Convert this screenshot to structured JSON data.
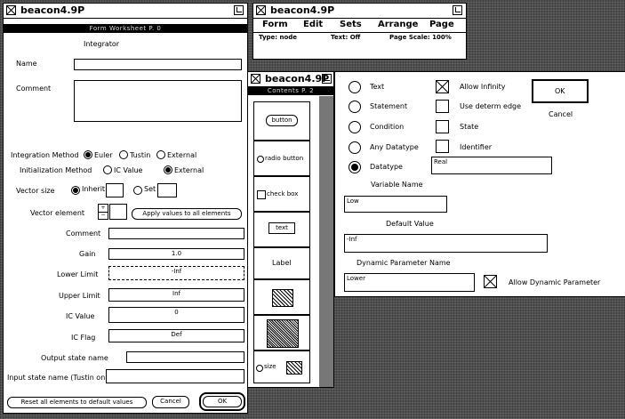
{
  "form_window": {
    "title": "beacon4.9P",
    "banner": "Form Worksheet P. 0",
    "heading": "Integrator",
    "name_label": "Name",
    "comment_label": "Comment",
    "integration_method_label": "Integration Method",
    "integration_options": [
      "Euler",
      "Tustin",
      "External"
    ],
    "integration_selected": "Euler",
    "init_method_label": "Initialization Method",
    "init_options": [
      "IC Value",
      "External"
    ],
    "init_selected": "External",
    "vector_size_label": "Vector size",
    "vector_size_options": [
      "Inherit",
      "Set"
    ],
    "vector_size_selected": "Inherit",
    "vector_element_label": "Vector element",
    "apply_button": "Apply values to all elements",
    "rows": [
      {
        "label": "Comment",
        "value": ""
      },
      {
        "label": "Gain",
        "value": "1.0"
      },
      {
        "label": "Lower Limit",
        "value": "-Inf"
      },
      {
        "label": "Upper Limit",
        "value": "Inf"
      },
      {
        "label": "IC Value",
        "value": "0"
      },
      {
        "label": "IC Flag",
        "value": "Def"
      },
      {
        "label": "Output state name",
        "value": ""
      },
      {
        "label": "Input state name (Tustin only)",
        "value": ""
      }
    ],
    "reset_button": "Reset all elements to default values",
    "cancel_button": "Cancel",
    "ok_button": "OK"
  },
  "edit_window": {
    "title": "beacon4.9P",
    "menu": [
      "Form",
      "Edit",
      "Sets",
      "Arrange",
      "Page"
    ],
    "type_label": "Type: node",
    "text_label": "Text: Off",
    "scale_label": "Page Scale: 100%"
  },
  "palette_window": {
    "title": "beacon4.9P",
    "banner": "Contents P. 2",
    "items": [
      "button",
      "radio button",
      "check box",
      "text",
      "Label"
    ],
    "size_label": "size"
  },
  "properties": {
    "datatypes": [
      "Text",
      "Statement",
      "Condition",
      "Any Datatype",
      "Datatype"
    ],
    "datatype_selected": "Datatype",
    "checkboxes": [
      {
        "label": "Allow Infinity",
        "checked": true
      },
      {
        "label": "Use determ edge",
        "checked": false
      },
      {
        "label": "State",
        "checked": false
      },
      {
        "label": "Identifier",
        "checked": false
      }
    ],
    "datatype_value": "Real",
    "variable_name_label": "Variable Name",
    "variable_name_value": "Low",
    "default_value_label": "Default Value",
    "default_value_value": "-Inf",
    "dyn_param_label": "Dynamic Parameter Name",
    "dyn_param_value": "Lower",
    "allow_dyn_label": "Allow Dynamic Parameter",
    "allow_dyn_checked": true,
    "ok_button": "OK",
    "cancel_button": "Cancel"
  }
}
